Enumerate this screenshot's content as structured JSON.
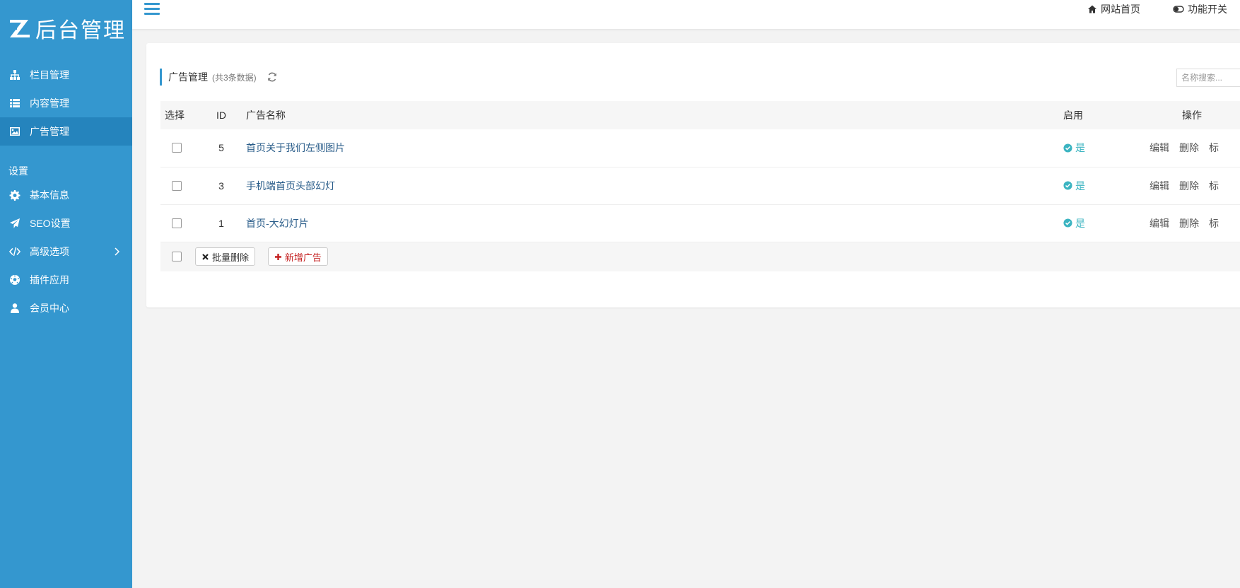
{
  "app": {
    "logo_text": "后台管理"
  },
  "sidebar": {
    "items": [
      {
        "label": "栏目管理",
        "icon": "sitemap-icon"
      },
      {
        "label": "内容管理",
        "icon": "list-icon"
      },
      {
        "label": "广告管理",
        "icon": "image-icon",
        "active": true
      }
    ],
    "section_label": "设置",
    "settings_items": [
      {
        "label": "基本信息",
        "icon": "gear-icon"
      },
      {
        "label": "SEO设置",
        "icon": "paper-plane-icon"
      },
      {
        "label": "高级选项",
        "icon": "code-icon",
        "has_submenu": true
      },
      {
        "label": "插件应用",
        "icon": "soccer-ball-icon"
      },
      {
        "label": "会员中心",
        "icon": "user-icon"
      }
    ]
  },
  "topbar": {
    "home_label": "网站首页",
    "toggle_label": "功能开关"
  },
  "panel": {
    "title": "广告管理",
    "subtitle": "(共3条数据)",
    "search_placeholder": "名称搜索..."
  },
  "table": {
    "headers": {
      "select": "选择",
      "id": "ID",
      "name": "广告名称",
      "enabled": "启用",
      "ops": "操作"
    },
    "rows": [
      {
        "id": "5",
        "name": "首页关于我们左侧图片",
        "enabled": "是"
      },
      {
        "id": "3",
        "name": "手机端首页头部幻灯",
        "enabled": "是"
      },
      {
        "id": "1",
        "name": "首页-大幻灯片",
        "enabled": "是"
      }
    ],
    "op_labels": {
      "edit": "编辑",
      "delete": "删除",
      "mark": "标"
    },
    "batch_delete_label": "批量删除",
    "add_label": "新增广告"
  },
  "colors": {
    "sidebar": "#3497cf",
    "sidebar_active": "#2584bd",
    "enabled": "#3bb4c1",
    "add_button": "#c41e1e"
  }
}
